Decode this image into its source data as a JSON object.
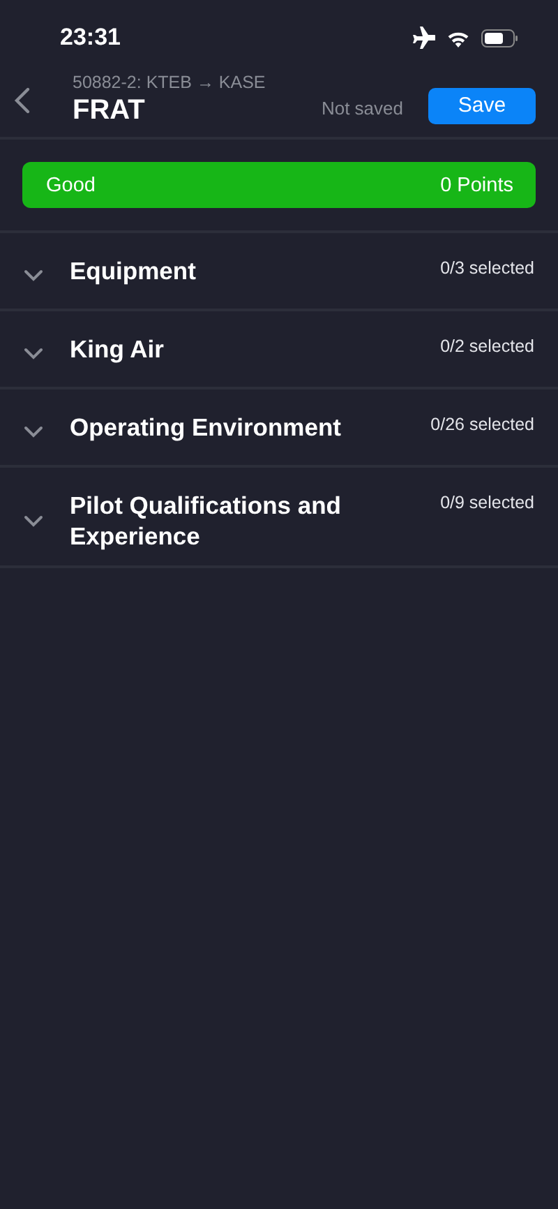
{
  "status_bar": {
    "time": "23:31"
  },
  "header": {
    "subtitle": "50882-2: KTEB → KASE",
    "title": "FRAT",
    "save_state": "Not saved",
    "save_button": "Save"
  },
  "risk": {
    "rating": "Good",
    "points": "0 Points"
  },
  "sections": [
    {
      "title": "Equipment",
      "count": "0/3 selected",
      "expanded": false
    },
    {
      "title": "King Air",
      "count": "0/2 selected",
      "expanded": false
    },
    {
      "title": "Operating Environment",
      "count": "0/26 selected",
      "expanded": false
    },
    {
      "title": "Pilot Qualifications and Experience",
      "count": "0/9 selected",
      "expanded": false
    }
  ]
}
